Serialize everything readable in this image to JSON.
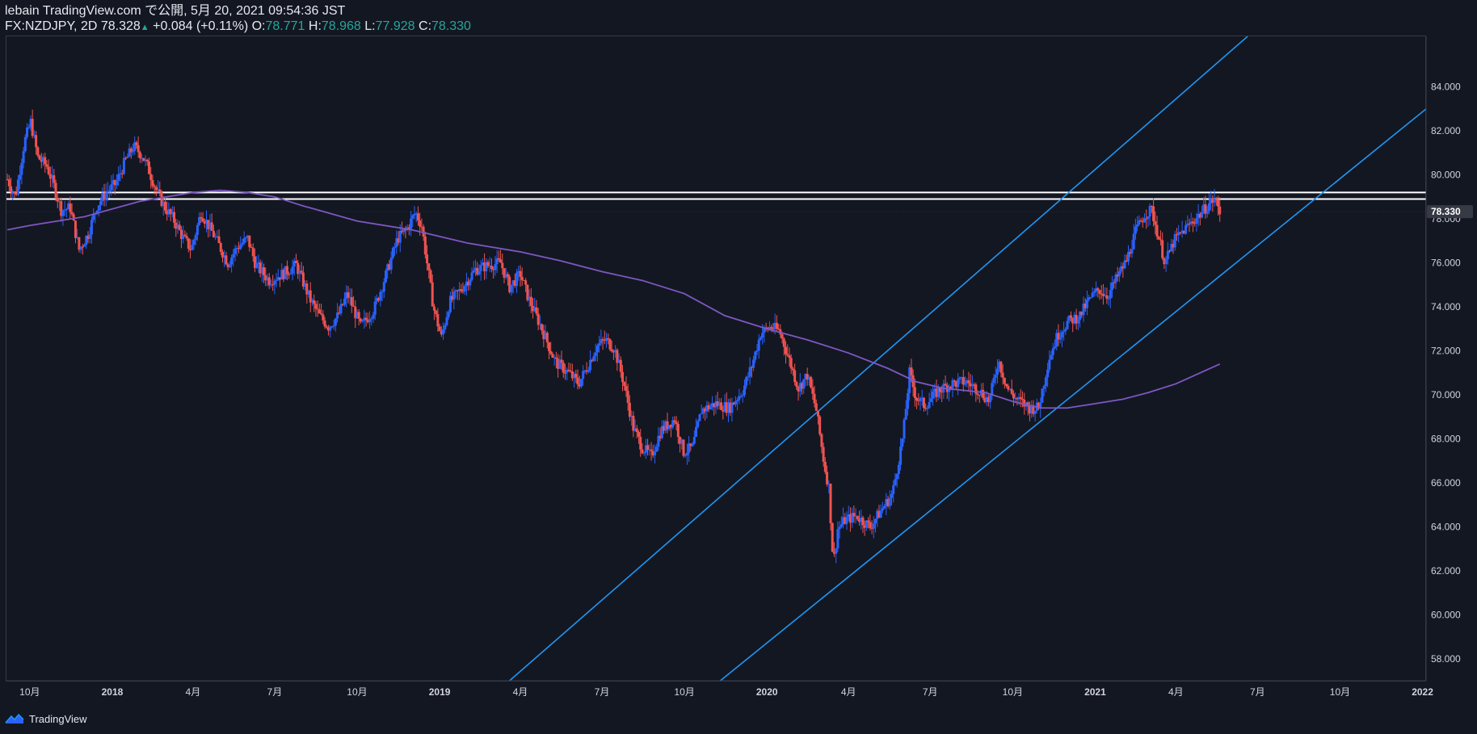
{
  "header": {
    "publisher_line": "lebain TradingView.com で公開, 5月 20, 2021 09:54:36 JST",
    "symbol": "FX:NZDJPY, 2D",
    "last": "78.328",
    "up_arrow": "▲",
    "change": "+0.084 (+0.11%)",
    "o_label": "O:",
    "o_value": "78.771",
    "h_label": "H:",
    "h_value": "78.968",
    "l_label": "L:",
    "l_value": "77.928",
    "c_label": "C:",
    "c_value": "78.330"
  },
  "footer": {
    "brand": "TradingView",
    "logo_icon": "tradingview-logo-icon"
  },
  "colors": {
    "background": "#131722",
    "up": "#2962ff",
    "down": "#ef5350",
    "ma": "#7e57c2",
    "channel": "#2196f3",
    "hline": "#ffffff",
    "price_badge": "#363a45"
  },
  "chart_data": {
    "type": "candlestick",
    "symbol": "NZDJPY",
    "timeframe": "2D",
    "x_tick_labels": [
      "10月",
      "2018",
      "4月",
      "7月",
      "10月",
      "2019",
      "4月",
      "7月",
      "10月",
      "2020",
      "4月",
      "7月",
      "10月",
      "2021",
      "4月",
      "7月",
      "10月",
      "2022"
    ],
    "x_tick_dates": [
      "2017-10-01",
      "2018-01-01",
      "2018-04-01",
      "2018-07-01",
      "2018-10-01",
      "2019-01-01",
      "2019-04-01",
      "2019-07-01",
      "2019-10-01",
      "2020-01-01",
      "2020-04-01",
      "2020-07-01",
      "2020-10-01",
      "2021-01-01",
      "2021-04-01",
      "2021-07-01",
      "2021-10-01",
      "2022-01-01"
    ],
    "y_tick_labels": [
      "58.000",
      "60.000",
      "62.000",
      "64.000",
      "66.000",
      "68.000",
      "70.000",
      "72.000",
      "74.000",
      "76.000",
      "78.000",
      "80.000",
      "82.000",
      "84.000"
    ],
    "ylim": [
      57.0,
      86.3
    ],
    "xlim": [
      "2017-09-05",
      "2022-01-05"
    ],
    "current_price_label": "78.330",
    "current_price": 78.33,
    "close_path": [
      [
        "2017-09-06",
        79.8
      ],
      [
        "2017-09-15",
        79.0
      ],
      [
        "2017-09-25",
        81.5
      ],
      [
        "2017-10-02",
        82.4
      ],
      [
        "2017-10-10",
        80.8
      ],
      [
        "2017-10-20",
        80.4
      ],
      [
        "2017-10-28",
        79.5
      ],
      [
        "2017-11-05",
        78.4
      ],
      [
        "2017-11-15",
        78.5
      ],
      [
        "2017-11-25",
        76.6
      ],
      [
        "2017-12-05",
        77.3
      ],
      [
        "2017-12-15",
        78.6
      ],
      [
        "2017-12-25",
        79.2
      ],
      [
        "2018-01-05",
        79.6
      ],
      [
        "2018-01-15",
        80.6
      ],
      [
        "2018-01-25",
        81.3
      ],
      [
        "2018-02-03",
        80.9
      ],
      [
        "2018-02-10",
        80.3
      ],
      [
        "2018-02-20",
        79.2
      ],
      [
        "2018-03-01",
        78.5
      ],
      [
        "2018-03-10",
        78.0
      ],
      [
        "2018-03-20",
        77.2
      ],
      [
        "2018-03-30",
        76.6
      ],
      [
        "2018-04-10",
        78.3
      ],
      [
        "2018-04-25",
        77.2
      ],
      [
        "2018-05-10",
        76.0
      ],
      [
        "2018-05-20",
        76.7
      ],
      [
        "2018-06-01",
        77.1
      ],
      [
        "2018-06-10",
        75.9
      ],
      [
        "2018-06-25",
        75.2
      ],
      [
        "2018-07-10",
        75.5
      ],
      [
        "2018-07-25",
        75.9
      ],
      [
        "2018-08-10",
        74.3
      ],
      [
        "2018-08-20",
        73.6
      ],
      [
        "2018-08-30",
        73.1
      ],
      [
        "2018-09-10",
        73.6
      ],
      [
        "2018-09-20",
        74.6
      ],
      [
        "2018-10-05",
        73.1
      ],
      [
        "2018-10-20",
        73.9
      ],
      [
        "2018-11-05",
        75.8
      ],
      [
        "2018-11-15",
        77.1
      ],
      [
        "2018-11-25",
        77.5
      ],
      [
        "2018-12-05",
        78.3
      ],
      [
        "2018-12-12",
        77.7
      ],
      [
        "2018-12-25",
        74.0
      ],
      [
        "2019-01-03",
        72.6
      ],
      [
        "2019-01-12",
        74.2
      ],
      [
        "2019-01-25",
        74.8
      ],
      [
        "2019-02-10",
        75.7
      ],
      [
        "2019-02-25",
        75.9
      ],
      [
        "2019-03-10",
        76.0
      ],
      [
        "2019-03-20",
        74.9
      ],
      [
        "2019-04-01",
        75.5
      ],
      [
        "2019-04-10",
        74.4
      ],
      [
        "2019-04-25",
        73.0
      ],
      [
        "2019-05-10",
        71.5
      ],
      [
        "2019-05-25",
        71.0
      ],
      [
        "2019-06-05",
        70.5
      ],
      [
        "2019-06-15",
        71.3
      ],
      [
        "2019-06-25",
        72.2
      ],
      [
        "2019-07-05",
        72.5
      ],
      [
        "2019-07-15",
        72.1
      ],
      [
        "2019-07-25",
        70.6
      ],
      [
        "2019-08-05",
        68.5
      ],
      [
        "2019-08-15",
        67.6
      ],
      [
        "2019-08-25",
        67.2
      ],
      [
        "2019-09-05",
        68.4
      ],
      [
        "2019-09-20",
        68.9
      ],
      [
        "2019-09-30",
        67.4
      ],
      [
        "2019-10-10",
        67.6
      ],
      [
        "2019-10-20",
        69.3
      ],
      [
        "2019-11-05",
        69.6
      ],
      [
        "2019-11-20",
        69.4
      ],
      [
        "2019-12-05",
        70.2
      ],
      [
        "2019-12-15",
        71.3
      ],
      [
        "2019-12-25",
        72.8
      ],
      [
        "2020-01-05",
        73.1
      ],
      [
        "2020-01-15",
        72.9
      ],
      [
        "2020-01-25",
        71.7
      ],
      [
        "2020-02-05",
        70.3
      ],
      [
        "2020-02-15",
        70.9
      ],
      [
        "2020-02-25",
        69.3
      ],
      [
        "2020-03-05",
        66.8
      ],
      [
        "2020-03-10",
        65.8
      ],
      [
        "2020-03-15",
        62.3
      ],
      [
        "2020-03-20",
        63.9
      ],
      [
        "2020-03-28",
        64.3
      ],
      [
        "2020-04-10",
        64.5
      ],
      [
        "2020-04-25",
        64.0
      ],
      [
        "2020-05-10",
        64.9
      ],
      [
        "2020-05-20",
        65.5
      ],
      [
        "2020-06-01",
        68.2
      ],
      [
        "2020-06-08",
        71.0
      ],
      [
        "2020-06-15",
        69.9
      ],
      [
        "2020-06-25",
        69.5
      ],
      [
        "2020-07-10",
        70.2
      ],
      [
        "2020-07-25",
        70.5
      ],
      [
        "2020-08-10",
        70.6
      ],
      [
        "2020-08-25",
        70.2
      ],
      [
        "2020-09-05",
        69.7
      ],
      [
        "2020-09-15",
        71.6
      ],
      [
        "2020-09-25",
        70.3
      ],
      [
        "2020-10-05",
        69.8
      ],
      [
        "2020-10-20",
        69.4
      ],
      [
        "2020-10-30",
        69.4
      ],
      [
        "2020-11-10",
        71.6
      ],
      [
        "2020-11-20",
        72.7
      ],
      [
        "2020-12-01",
        73.3
      ],
      [
        "2020-12-15",
        73.6
      ],
      [
        "2020-12-25",
        74.3
      ],
      [
        "2021-01-05",
        74.8
      ],
      [
        "2021-01-15",
        74.5
      ],
      [
        "2021-01-25",
        75.3
      ],
      [
        "2021-02-05",
        76.1
      ],
      [
        "2021-02-15",
        77.4
      ],
      [
        "2021-02-25",
        78.2
      ],
      [
        "2021-03-05",
        78.4
      ],
      [
        "2021-03-10",
        77.6
      ],
      [
        "2021-03-20",
        76.0
      ],
      [
        "2021-03-30",
        77.0
      ],
      [
        "2021-04-10",
        77.5
      ],
      [
        "2021-04-20",
        77.9
      ],
      [
        "2021-04-30",
        78.3
      ],
      [
        "2021-05-08",
        78.7
      ],
      [
        "2021-05-14",
        78.9
      ],
      [
        "2021-05-20",
        78.33
      ]
    ],
    "ma200": [
      [
        "2017-09-06",
        77.5
      ],
      [
        "2017-10-01",
        77.7
      ],
      [
        "2017-12-01",
        78.1
      ],
      [
        "2018-02-01",
        78.8
      ],
      [
        "2018-04-01",
        79.2
      ],
      [
        "2018-05-01",
        79.3
      ],
      [
        "2018-06-01",
        79.2
      ],
      [
        "2018-07-01",
        79.0
      ],
      [
        "2018-08-01",
        78.6
      ],
      [
        "2018-10-01",
        77.9
      ],
      [
        "2018-12-01",
        77.5
      ],
      [
        "2019-02-01",
        76.9
      ],
      [
        "2019-04-01",
        76.5
      ],
      [
        "2019-05-15",
        76.1
      ],
      [
        "2019-07-01",
        75.6
      ],
      [
        "2019-08-15",
        75.2
      ],
      [
        "2019-10-01",
        74.6
      ],
      [
        "2019-11-15",
        73.6
      ],
      [
        "2020-01-01",
        73.0
      ],
      [
        "2020-02-15",
        72.5
      ],
      [
        "2020-04-01",
        71.9
      ],
      [
        "2020-05-15",
        71.2
      ],
      [
        "2020-06-15",
        70.6
      ],
      [
        "2020-07-15",
        70.3
      ],
      [
        "2020-09-01",
        70.1
      ],
      [
        "2020-10-01",
        69.7
      ],
      [
        "2020-11-01",
        69.4
      ],
      [
        "2020-12-01",
        69.4
      ],
      [
        "2021-01-01",
        69.6
      ],
      [
        "2021-02-01",
        69.8
      ],
      [
        "2021-03-01",
        70.1
      ],
      [
        "2021-04-01",
        70.5
      ],
      [
        "2021-05-20",
        71.4
      ]
    ],
    "horizontal_lines": [
      79.2,
      78.9
    ],
    "channel_upper": [
      [
        "2019-03-20",
        57.0
      ],
      [
        "2021-06-20",
        86.3
      ]
    ],
    "channel_lower": [
      [
        "2019-11-10",
        57.0
      ],
      [
        "2022-01-05",
        83.0
      ]
    ],
    "indicators": [
      {
        "name": "MA",
        "color": "#7e57c2"
      }
    ],
    "grid": false,
    "legend": "none"
  }
}
